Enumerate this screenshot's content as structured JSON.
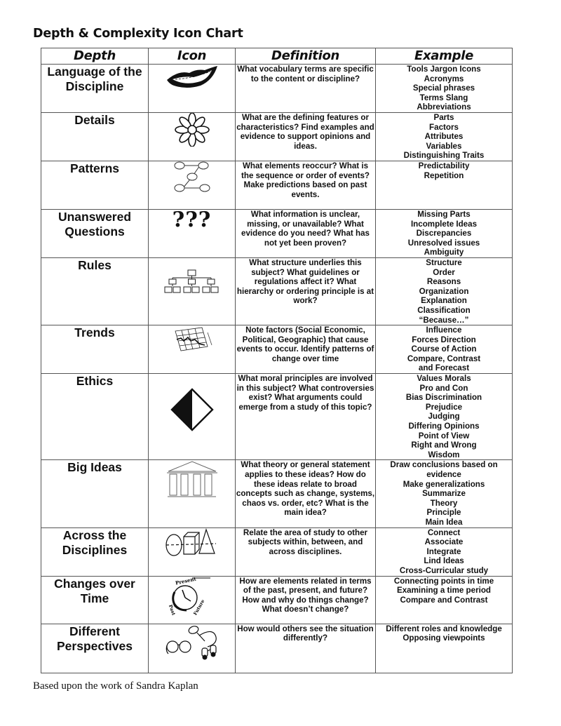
{
  "title": "Depth & Complexity Icon Chart",
  "headers": {
    "depth": "Depth",
    "icon": "Icon",
    "definition": "Definition",
    "example": "Example"
  },
  "rows": [
    {
      "depth": "Language of the Discipline",
      "icon": "lips-icon",
      "definition": "What vocabulary terms are specific to the content or discipline?",
      "examples": [
        "Tools Jargon Icons",
        "Acronyms",
        "Special phrases",
        "Terms Slang",
        "Abbreviations"
      ]
    },
    {
      "depth": "Details",
      "icon": "flower-icon",
      "definition": "What are the defining features or characteristics? Find examples and evidence to support opinions and ideas.",
      "examples": [
        "Parts",
        "Factors",
        "Attributes",
        "Variables",
        "Distinguishing Traits"
      ]
    },
    {
      "depth": "Patterns",
      "icon": "connected-circles-icon",
      "definition": "What elements reoccur? What is the sequence or order of events? Make predictions based on past events.",
      "examples": [
        "Predictability",
        "Repetition"
      ]
    },
    {
      "depth": "Unanswered Questions",
      "icon": "question-marks-icon",
      "definition": "What information is unclear, missing, or unavailable? What evidence do you need? What has not yet been proven?",
      "examples": [
        "Missing Parts",
        "Incomplete Ideas",
        "Discrepancies",
        "Unresolved issues",
        "Ambiguity"
      ]
    },
    {
      "depth": "Rules",
      "icon": "hierarchy-chart-icon",
      "definition": "What structure underlies this subject? What guidelines or regulations affect it? What hierarchy or ordering principle is at work?",
      "examples": [
        "Structure",
        "Order",
        "Reasons",
        "Organization",
        "Explanation",
        "Classification",
        "“Because…”"
      ]
    },
    {
      "depth": "Trends",
      "icon": "trend-graph-icon",
      "definition": "Note factors (Social Economic, Political, Geographic) that cause events to occur. Identify patterns of change over time",
      "examples": [
        "Influence",
        "Forces Direction",
        "Course of Action",
        "Compare, Contrast",
        "and Forecast"
      ]
    },
    {
      "depth": "Ethics",
      "icon": "half-diamond-icon",
      "definition": "What moral principles are involved in this subject? What controversies exist? What arguments could emerge from a study of this topic?",
      "examples": [
        "Values Morals",
        "Pro and Con",
        "Bias Discrimination",
        "Prejudice",
        "Judging",
        "Differing Opinions",
        "Point of View",
        "Right and Wrong",
        "Wisdom"
      ]
    },
    {
      "depth": "Big Ideas",
      "icon": "greek-temple-icon",
      "definition": "What theory or general statement applies to these ideas? How do these ideas relate to broad concepts such as change, systems, chaos vs. order, etc? What is the main idea?",
      "examples": [
        "Draw conclusions based on",
        "evidence",
        "Make generalizations",
        "Summarize",
        "Theory",
        "Principle",
        "Main Idea"
      ]
    },
    {
      "depth": "Across the Disciplines",
      "icon": "shapes-icon",
      "definition": "Relate the area of study to other subjects within, between, and across disciplines.",
      "examples": [
        "Connect",
        "Associate",
        "Integrate",
        "Lind Ideas",
        "Cross-Curricular study"
      ]
    },
    {
      "depth": "Changes over Time",
      "icon": "clock-icon",
      "definition": "How are elements related in terms of the past, present, and future? How and why do things change? What doesn’t change?",
      "examples": [
        "Connecting points in time",
        "Examining a time period",
        "Compare and Contrast"
      ]
    },
    {
      "depth": "Different Perspectives",
      "icon": "glasses-binoculars-icon",
      "definition": "How would others see the situation differently?",
      "examples": [
        "Different roles and knowledge",
        "Opposing viewpoints"
      ]
    }
  ],
  "icon_text": {
    "clock_present": "Present",
    "clock_past": "Past",
    "clock_future": "Future",
    "question_marks": "???"
  },
  "footer": "Based upon the work of Sandra Kaplan"
}
